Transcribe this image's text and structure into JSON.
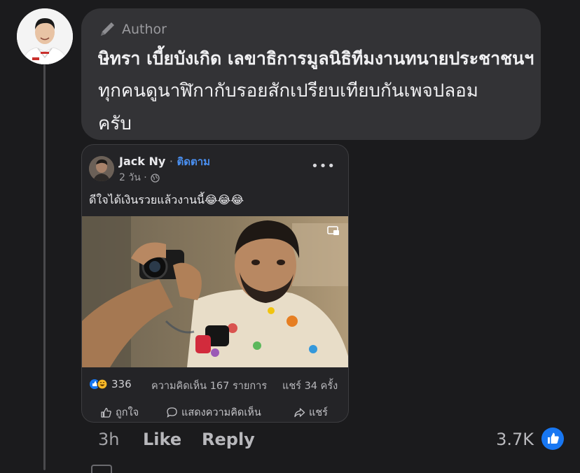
{
  "comment": {
    "badge": "Author",
    "lines": [
      "ษิทรา เบี้ยบังเกิด เลขาธิการมูลนิธิทีมงานทนายประชาชนฯ",
      "ทุกคนดูนาฬิกากับรอยสักเปรียบเทียบกันเพจปลอม",
      "ครับ"
    ],
    "time": "3h",
    "like_label": "Like",
    "reply_label": "Reply",
    "reaction_count": "3.7K"
  },
  "embedded_post": {
    "author": "Jack Ny",
    "separator": "·",
    "follow_label": "ติดตาม",
    "time": "2 วัน ·",
    "text": "ดีใจได้เงินรวยแล้วงานนี้😂😂😂",
    "reaction_count": "336",
    "comments_text": "ความคิดเห็น 167 รายการ",
    "shares_text": "แชร์ 34 ครั้ง",
    "like_action": "ถูกใจ",
    "comment_action": "แสดงความคิดเห็น",
    "share_action": "แชร์"
  },
  "colors": {
    "background": "#1b1b1d",
    "bubble": "#333336",
    "accent_blue": "#1877f2",
    "follow_blue": "#4a8ff0"
  }
}
